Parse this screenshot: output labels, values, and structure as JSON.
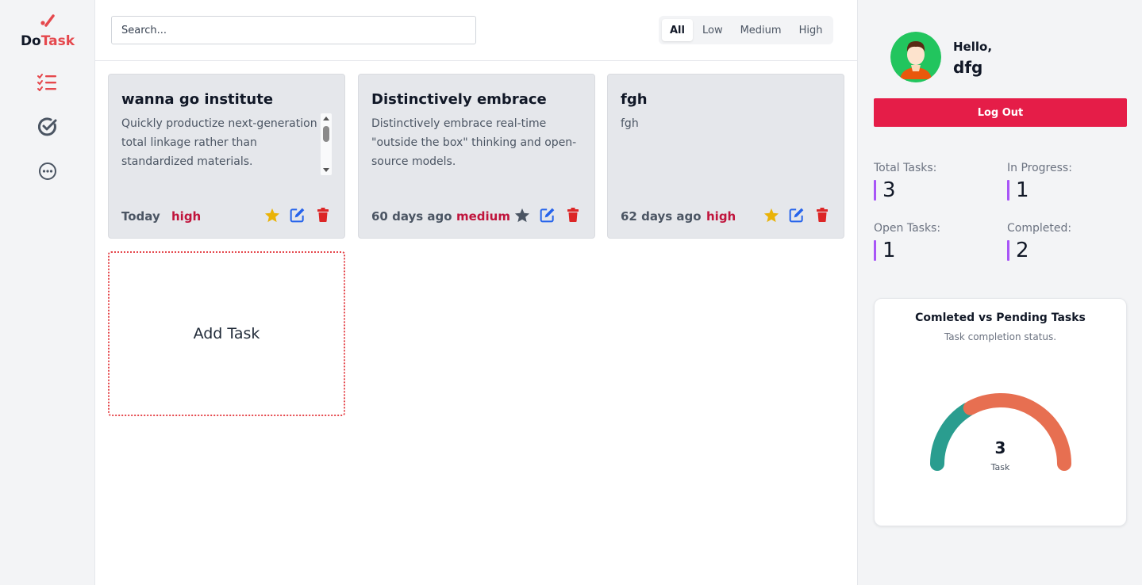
{
  "app": {
    "logo_do": "Do",
    "logo_task": "Task"
  },
  "nav": {
    "items": [
      {
        "name": "tasks-list-icon",
        "active": true
      },
      {
        "name": "completed-icon",
        "active": false
      },
      {
        "name": "more-icon",
        "active": false
      }
    ]
  },
  "search": {
    "placeholder": "Search...",
    "value": ""
  },
  "filters": {
    "options": [
      "All",
      "Low",
      "Medium",
      "High"
    ],
    "selected": "All"
  },
  "tasks": [
    {
      "title": "wanna go institute",
      "description": "Quickly productize next-generation total linkage rather than standardized materials. Distinctively delivers real-time",
      "date": "Today",
      "priority": "high",
      "starred": true
    },
    {
      "title": "Distinctively embrace",
      "description": "Distinctively embrace real-time \"outside the box\" thinking and open-source models.",
      "date": "60 days ago",
      "priority": "medium",
      "starred": false
    },
    {
      "title": "fgh",
      "description": "fgh",
      "date": "62 days ago",
      "priority": "high",
      "starred": true
    }
  ],
  "add_task": {
    "label": "Add Task"
  },
  "profile": {
    "greeting": "Hello,",
    "username": "dfg",
    "logout_label": "Log Out"
  },
  "stats": {
    "total_label": "Total Tasks:",
    "total_value": "3",
    "in_progress_label": "In Progress:",
    "in_progress_value": "1",
    "open_label": "Open Tasks:",
    "open_value": "1",
    "completed_label": "Completed:",
    "completed_value": "2"
  },
  "colors": {
    "accent": "#e5484d",
    "logout": "#e51d48",
    "priority_text": "#c0143c",
    "stat_bar": "#a855f7",
    "gauge_pending": "#2a9d8f",
    "gauge_completed": "#e76f51",
    "star_active": "#eab308",
    "star_inactive": "#4b5563",
    "edit": "#2563eb",
    "delete": "#dc2626"
  },
  "chart_data": {
    "type": "radial-gauge",
    "title": "Comleted vs Pending Tasks",
    "subtitle": "Task completion status.",
    "center_value": "3",
    "center_label": "Task",
    "segments": [
      {
        "value": 1
      },
      {
        "value": 2
      }
    ]
  }
}
